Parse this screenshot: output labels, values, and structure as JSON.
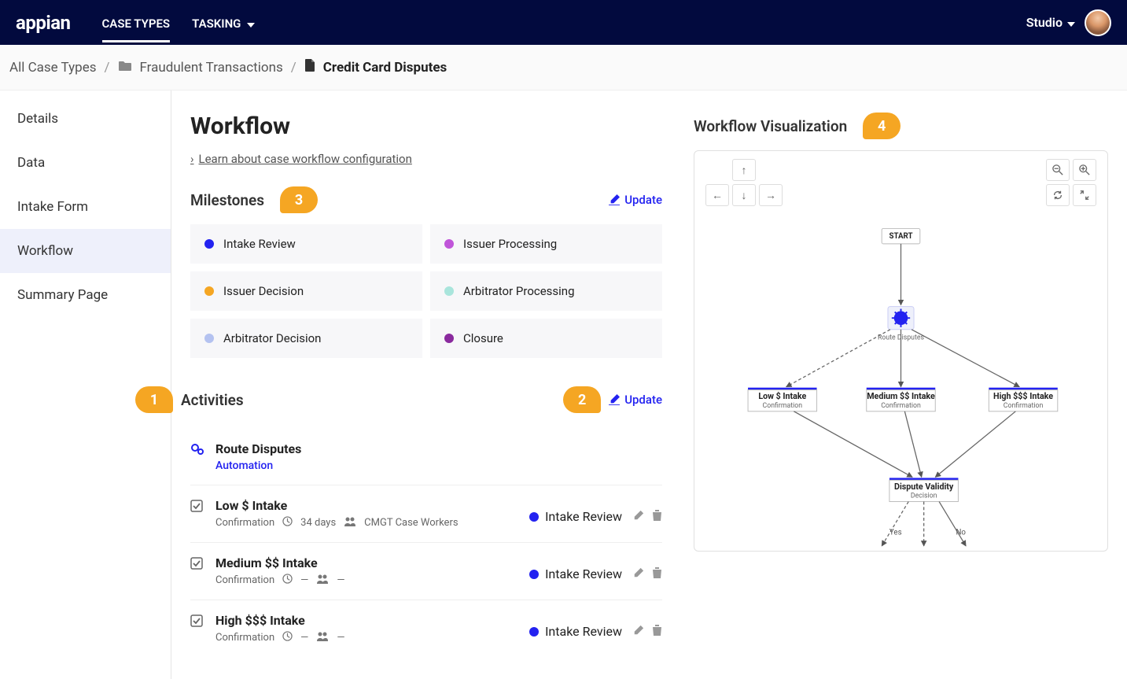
{
  "header": {
    "logo": "appian",
    "tabs": [
      {
        "label": "CASE TYPES",
        "active": true
      },
      {
        "label": "TASKING",
        "active": false,
        "dropdown": true
      }
    ],
    "studio_label": "Studio"
  },
  "breadcrumb": {
    "root": "All Case Types",
    "folder": "Fraudulent Transactions",
    "current": "Credit Card Disputes"
  },
  "sidebar": {
    "items": [
      {
        "label": "Details"
      },
      {
        "label": "Data"
      },
      {
        "label": "Intake Form"
      },
      {
        "label": "Workflow",
        "active": true
      },
      {
        "label": "Summary Page"
      }
    ]
  },
  "page": {
    "title": "Workflow",
    "learn_link": "Learn about case workflow configuration"
  },
  "callouts": {
    "c1": "1",
    "c2": "2",
    "c3": "3",
    "c4": "4"
  },
  "milestones": {
    "title": "Milestones",
    "update_label": "Update",
    "items": [
      {
        "label": "Intake Review",
        "color": "#2322f0"
      },
      {
        "label": "Issuer Processing",
        "color": "#c055d9"
      },
      {
        "label": "Issuer Decision",
        "color": "#f5a623"
      },
      {
        "label": "Arbitrator Processing",
        "color": "#a9e5dc"
      },
      {
        "label": "Arbitrator Decision",
        "color": "#b4c2f0"
      },
      {
        "label": "Closure",
        "color": "#8a2a9e"
      }
    ]
  },
  "activities": {
    "title": "Activities",
    "update_label": "Update",
    "items": [
      {
        "title": "Route Disputes",
        "subtype": "Automation",
        "icon": "gears",
        "milestone": null
      },
      {
        "title": "Low $ Intake",
        "subtype": "Confirmation",
        "duration": "34 days",
        "assignee": "CMGT Case Workers",
        "milestone": "Intake Review",
        "icon": "check"
      },
      {
        "title": "Medium $$ Intake",
        "subtype": "Confirmation",
        "duration": "—",
        "assignee": "—",
        "milestone": "Intake Review",
        "icon": "check"
      },
      {
        "title": "High $$$ Intake",
        "subtype": "Confirmation",
        "duration": "—",
        "assignee": "—",
        "milestone": "Intake Review",
        "icon": "check"
      }
    ]
  },
  "visualization": {
    "title": "Workflow Visualization",
    "start_label": "START",
    "route_label": "Route Disputes",
    "nodes": [
      {
        "title": "Low $ Intake",
        "sub": "Confirmation"
      },
      {
        "title": "Medium $$ Intake",
        "sub": "Confirmation"
      },
      {
        "title": "High $$$ Intake",
        "sub": "Confirmation"
      },
      {
        "title": "Dispute Validity",
        "sub": "Decision"
      }
    ],
    "yes_label": "Yes",
    "no_label": "No"
  }
}
